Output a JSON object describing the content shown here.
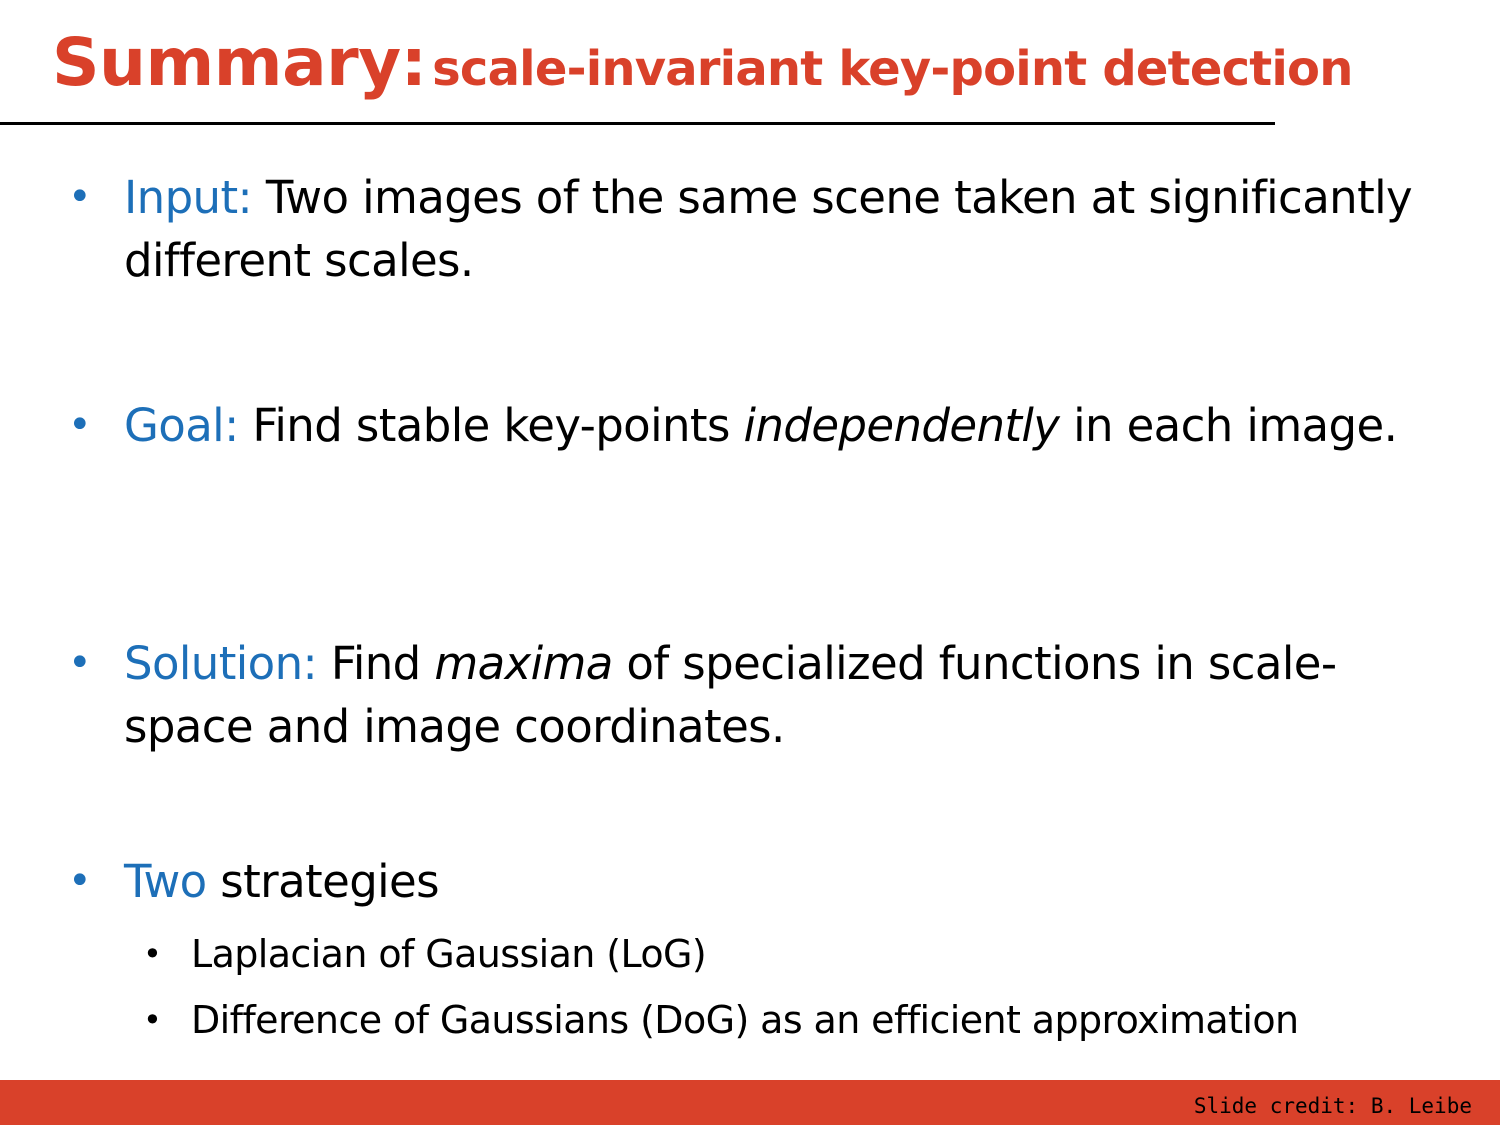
{
  "title": {
    "main": "Summary:",
    "sub": "scale-invariant key-point detection"
  },
  "bullets": [
    {
      "keyword": "Input:",
      "text": "Two images of the same scene taken at significantly different scales."
    },
    {
      "keyword": "Goal:",
      "text_before": "Find stable key-points",
      "emphasis": "independently",
      "text_after": "in each image."
    },
    {
      "keyword": "Solution:",
      "text_before": "Find",
      "emphasis": "maxima",
      "text_after": "of specialized functions in scale-space and image coordinates."
    },
    {
      "keyword": "Two",
      "text": "strategies",
      "sub_items": [
        "Laplacian of Gaussian (LoG)",
        "Difference of Gaussians (DoG) as an efficient approximation"
      ]
    }
  ],
  "footer": {
    "credit": "Slide credit: B. Leibe"
  },
  "colors": {
    "title": "#d9412a",
    "keyword": "#1d6fb8",
    "footer_bar": "#d9412a"
  }
}
